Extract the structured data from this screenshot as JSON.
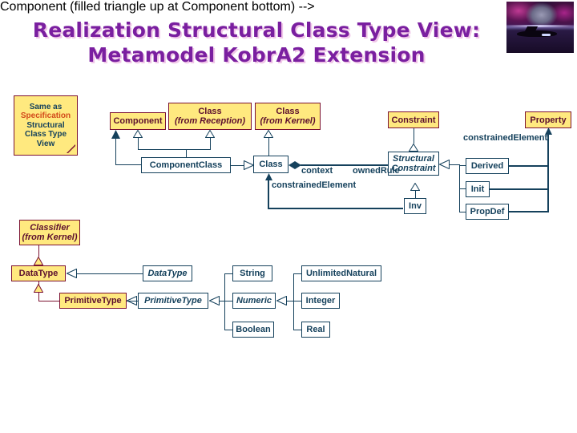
{
  "slide": {
    "title": "Realization Structural Class Type View:\nMetamodel KobrA2 Extension",
    "title_color": "#7a1fa0",
    "background": "#ffffff"
  },
  "corner_image": {
    "name": "space-scene-thumbnail",
    "description": "purple nebula with moon and dark spaceship silhouette over water"
  },
  "note": {
    "line1": "Same as",
    "line2": "Specification",
    "line3": "Structural",
    "line4": "Class Type",
    "line5": "View",
    "highlight_color": "#d2491a",
    "fill": "#ffe97f",
    "border": "#7b1232"
  },
  "palette": {
    "metamodel_fill": "#ffe97f",
    "metamodel_border": "#7b1232",
    "metamodel_text": "#5c0f2e",
    "new_class_fill": "#ffffff",
    "new_class_border": "#15415c",
    "new_class_text": "#15415c"
  },
  "metamodel_classes": [
    {
      "id": "component",
      "name": "Component",
      "qualifier": ""
    },
    {
      "id": "class-reception",
      "name": "Class",
      "qualifier": "(from Reception)"
    },
    {
      "id": "class-kernel",
      "name": "Class",
      "qualifier": "(from Kernel)"
    },
    {
      "id": "constraint",
      "name": "Constraint",
      "qualifier": ""
    },
    {
      "id": "property",
      "name": "Property",
      "qualifier": ""
    },
    {
      "id": "classifier",
      "name": "Classifier",
      "qualifier": "(from Kernel)"
    },
    {
      "id": "datatype-mm",
      "name": "DataType",
      "qualifier": ""
    },
    {
      "id": "primitivetype-mm",
      "name": "PrimitiveType",
      "qualifier": ""
    }
  ],
  "realization_classes": [
    {
      "id": "componentclass",
      "name": "ComponentClass",
      "abstract": false
    },
    {
      "id": "class",
      "name": "Class",
      "abstract": false
    },
    {
      "id": "structuralconstraint",
      "name": "Structural Constraint",
      "abstract": true
    },
    {
      "id": "derived",
      "name": "Derived",
      "abstract": false
    },
    {
      "id": "init",
      "name": "Init",
      "abstract": false
    },
    {
      "id": "propdef",
      "name": "PropDef",
      "abstract": false
    },
    {
      "id": "inv",
      "name": "Inv",
      "abstract": false
    },
    {
      "id": "datatype",
      "name": "DataType",
      "abstract": true
    },
    {
      "id": "primitivetype",
      "name": "PrimitiveType",
      "abstract": true
    },
    {
      "id": "string",
      "name": "String",
      "abstract": false
    },
    {
      "id": "numeric",
      "name": "Numeric",
      "abstract": true
    },
    {
      "id": "boolean",
      "name": "Boolean",
      "abstract": false
    },
    {
      "id": "unlimitednatural",
      "name": "UnlimitedNatural",
      "abstract": false
    },
    {
      "id": "integer",
      "name": "Integer",
      "abstract": false
    },
    {
      "id": "real",
      "name": "Real",
      "abstract": false
    }
  ],
  "association_labels": [
    {
      "id": "context",
      "text": "context"
    },
    {
      "id": "ownedrule",
      "text": "ownedRule"
    },
    {
      "id": "constrainedelement-lower",
      "text": "constrainedElement"
    },
    {
      "id": "constrainedelement-upper",
      "text": "constrainedElement"
    }
  ],
  "box_text": {
    "component": "Component",
    "class_reception_l1": "Class",
    "class_reception_l2": "(from Reception)",
    "class_kernel_l1": "Class",
    "class_kernel_l2": "(from Kernel)",
    "constraint": "Constraint",
    "property": "Property",
    "classifier_l1": "Classifier",
    "classifier_l2": "(from Kernel)",
    "datatype_mm": "DataType",
    "primitivetype_mm": "PrimitiveType",
    "componentclass": "ComponentClass",
    "class": "Class",
    "structuralconstraint_l1": "Structural",
    "structuralconstraint_l2": "Constraint",
    "derived": "Derived",
    "init": "Init",
    "propdef": "PropDef",
    "inv": "Inv",
    "datatype": "DataType",
    "primitivetype": "PrimitiveType",
    "string": "String",
    "numeric": "Numeric",
    "boolean": "Boolean",
    "unlimitednatural": "UnlimitedNatural",
    "integer": "Integer",
    "real": "Real",
    "context": "context",
    "ownedrule": "ownedRule",
    "constrainedelement_lower": "constrainedElement",
    "constrainedelement_upper": "constrainedElement"
  }
}
